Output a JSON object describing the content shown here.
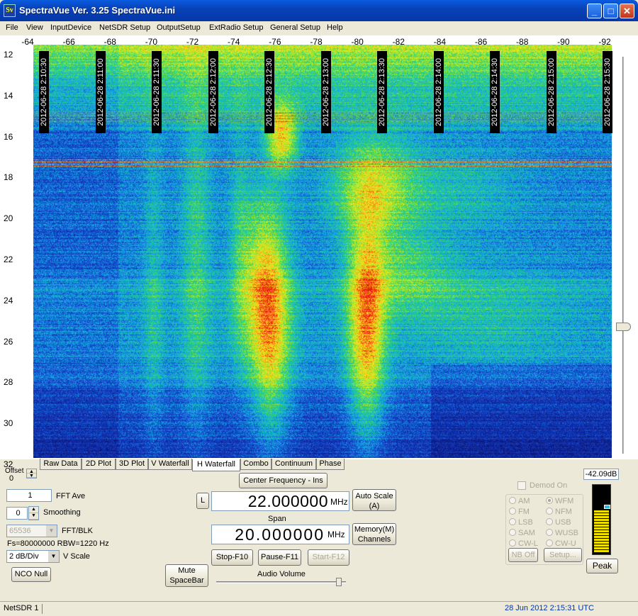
{
  "window": {
    "title": "SpectraVue Ver. 3.25  SpectraVue.ini",
    "app_icon": "Sv"
  },
  "menu": [
    "File",
    "View",
    "InputDevice",
    "NetSDR Setup",
    "OutputSetup",
    "ExtRadio Setup",
    "General Setup",
    "Help"
  ],
  "x_axis": {
    "ticks": [
      "-64",
      "-66",
      "-68",
      "-70",
      "-72",
      "-74",
      "-76",
      "-78",
      "-80",
      "-82",
      "-84",
      "-86",
      "-88",
      "-90",
      "-92"
    ]
  },
  "y_axis": {
    "ticks": [
      "12",
      "14",
      "16",
      "18",
      "20",
      "22",
      "24",
      "26",
      "28",
      "30",
      "32"
    ]
  },
  "waterfall_timestamps": [
    "2012-06-28 2:10:30",
    "2012-06-28 2:11:00",
    "2012-06-28 2:11:30",
    "2012-06-28 2:12:00",
    "2012-06-28 2:12:30",
    "2012-06-28 2:13:00",
    "2012-06-28 2:13:30",
    "2012-06-28 2:14:00",
    "2012-06-28 2:14:30",
    "2012-06-28 2:15:00",
    "2012-06-28 2:15:30"
  ],
  "tabs": [
    "Raw Data",
    "2D Plot",
    "3D Plot",
    "V Waterfall",
    "H Waterfall",
    "Combo",
    "Continuum",
    "Phase"
  ],
  "selected_tab": "H Waterfall",
  "offset": {
    "label": "Offset",
    "value": "0"
  },
  "fft_ave": {
    "value": "1",
    "label": "FFT Ave"
  },
  "smoothing": {
    "value": "0",
    "label": "Smoothing"
  },
  "fft_blk": {
    "value": "65536",
    "label": "FFT/BLK"
  },
  "fs_info": "Fs=80000000 RBW=1220 Hz",
  "vscale": {
    "value": "2 dB/Div",
    "label": "V Scale"
  },
  "buttons": {
    "nco_null": "NCO Null",
    "mute": "Mute SpaceBar",
    "center_freq": "Center Frequency - Ins",
    "l": "L",
    "auto_scale": "Auto Scale (A)",
    "memory": "Memory(M) Channels",
    "stop": "Stop-F10",
    "pause": "Pause-F11",
    "start": "Start-F12",
    "nb_off": "NB Off",
    "setup": "Setup...",
    "peak": "Peak"
  },
  "center_frequency": {
    "value": "22.000000",
    "unit": "MHz"
  },
  "span": {
    "label": "Span",
    "value": "20.000000",
    "unit": "MHz"
  },
  "audio_volume": "Audio Volume",
  "demod": {
    "label": "Demod On",
    "modes": [
      "AM",
      "WFM",
      "FM",
      "NFM",
      "LSB",
      "USB",
      "SAM",
      "WUSB",
      "CW-L",
      "CW-U"
    ],
    "selected": "WFM"
  },
  "level": {
    "readout": "-42.09dB",
    "fraction": 0.62
  },
  "status": {
    "device": "NetSDR 1",
    "datetime": "28 Jun 2012  2:15:31 UTC"
  },
  "colors": {
    "title_bar": "#0842b8",
    "plot_bg": "#0a1a8c",
    "hot": "#e8201a",
    "level_bar": "#f0e000"
  }
}
